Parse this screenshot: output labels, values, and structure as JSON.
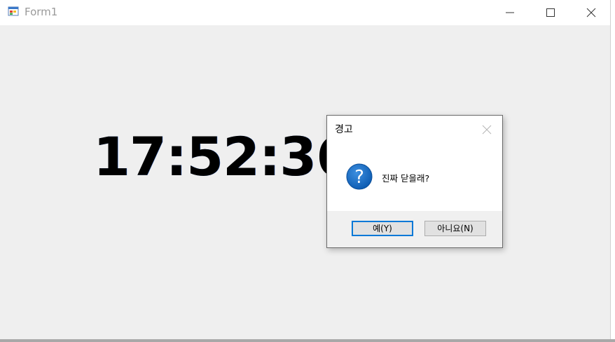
{
  "window": {
    "title": "Form1",
    "icon": "form-app-icon",
    "controls": [
      "minimize-icon",
      "maximize-icon",
      "close-icon"
    ]
  },
  "clock": {
    "time": "17:52:36"
  },
  "dialog": {
    "title": "경고",
    "icon": "question-icon",
    "message": "진짜 닫을래?",
    "yes_label": "예(Y)",
    "no_label": "아니요(N)"
  },
  "colors": {
    "accent": "#0078d7",
    "question_icon": "#1a6fc4",
    "window_bg": "#efefef"
  }
}
